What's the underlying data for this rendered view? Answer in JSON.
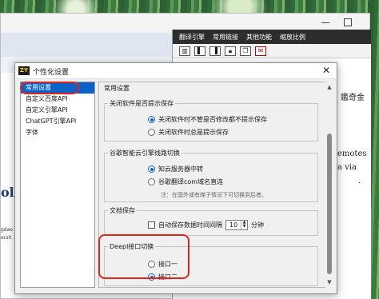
{
  "background_app": {
    "menu": [
      "翻译引擎",
      "常用链接",
      "其他功能",
      "缩放比例"
    ],
    "toolbar_icons": [
      "layout-icon",
      "layout-left-icon",
      "layout-right-icon",
      "lock-icon",
      "copy-icon",
      "mail-icon"
    ],
    "right_lines": [
      "鑑奇金",
      "emotes",
      "a  via",
      "."
    ],
    "left_lines": [
      "oli",
      "gdao",
      "ersit"
    ]
  },
  "dialog": {
    "title": "个性化设置",
    "icon_text": "ZY",
    "close": "✕",
    "nav_items": [
      "常用设置",
      "自定义百度API",
      "自定义引擎API",
      "ChatGPT引擎API",
      "字体"
    ],
    "selected_nav_index": 0,
    "section_title": "常用设置",
    "groups": {
      "close_behavior": {
        "title": "关闭软件是否提示保存",
        "options": [
          "关闭软件时不管是否修改都不提示保存",
          "关闭软件时总是提示保存"
        ],
        "selected": 0
      },
      "google_switch": {
        "title": "谷歌智能云引擎线路切换",
        "options": [
          "知云服务器中转",
          "谷歌翻译com域名直连"
        ],
        "selected": 0,
        "hint": "注：在国外或有梯子情况下可切换到后者。"
      },
      "doc_save": {
        "title": "文档保存",
        "checkbox_label": "自动保存数据时间间隔",
        "interval_value": "10",
        "unit": "分钟",
        "checked": false
      },
      "deepl_switch": {
        "title": "Deepl接口切换",
        "options": [
          "接口一",
          "接口二"
        ],
        "selected": 1
      }
    }
  },
  "colors": {
    "accent": "#0a62c8",
    "annotation": "#e0251d",
    "menubar": "#2d2d2d"
  }
}
